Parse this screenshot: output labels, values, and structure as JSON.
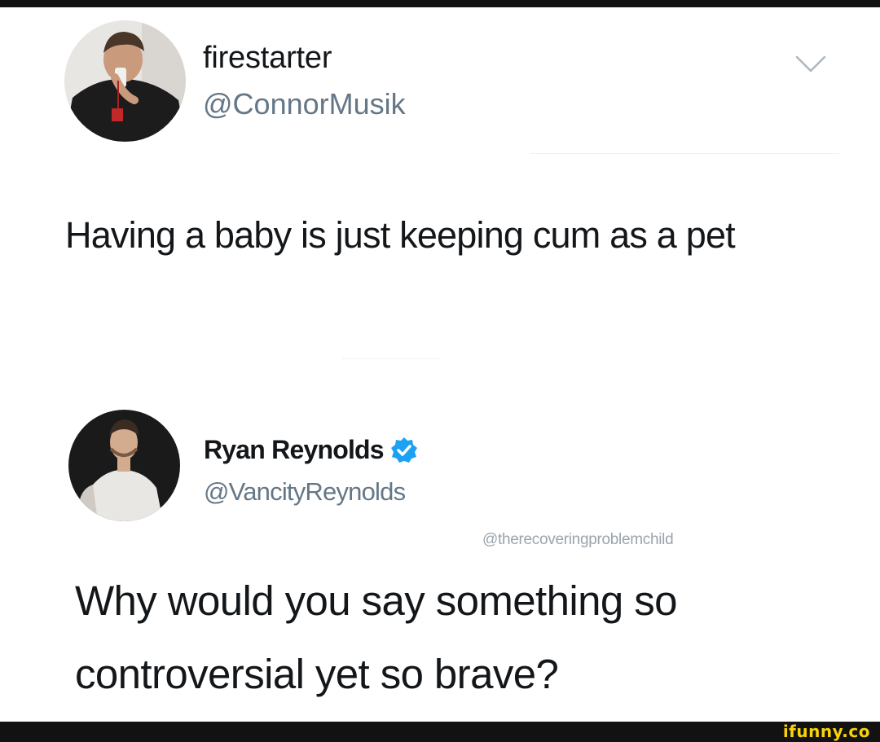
{
  "tweet": {
    "display_name": "firestarter",
    "handle": "@ConnorMusik",
    "text": "Having a baby is just keeping cum as a pet"
  },
  "reply": {
    "display_name": "Ryan Reynolds",
    "handle": "@VancityReynolds",
    "verified": true,
    "text": "Why would you say something so controversial yet so brave?"
  },
  "watermark": {
    "handle": "@therecoveringproblemchild",
    "site": "ifunny.co"
  },
  "icons": {
    "menu": "chevron-down-icon",
    "verified": "verified-badge-icon"
  },
  "colors": {
    "text_primary": "#14171a",
    "text_secondary": "#657786",
    "verified_blue": "#1da1f2",
    "ifunny_yellow": "#f8d20a",
    "frame_bar": "#121212"
  }
}
